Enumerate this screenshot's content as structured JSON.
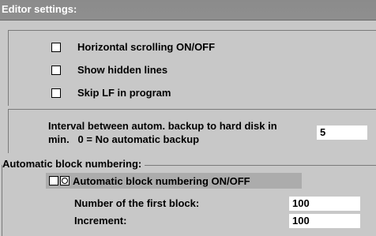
{
  "window": {
    "title": "Editor settings:"
  },
  "options": [
    {
      "label": "Horizontal scrolling ON/OFF",
      "checked": false
    },
    {
      "label": "Show hidden lines",
      "checked": false
    },
    {
      "label": "Skip LF in program",
      "checked": false
    }
  ],
  "backup": {
    "label_line1": "Interval between autom. backup to hard disk in",
    "label_line2": "min.   0 = No automatic backup",
    "value": "5"
  },
  "block_numbering": {
    "group_title": "Automatic block numbering:",
    "toggle_label": "Automatic block numbering ON/OFF",
    "toggle_checked": false,
    "first_block_label": "Number of the first block:",
    "first_block_value": "100",
    "increment_label": "Increment:",
    "increment_value": "100"
  }
}
